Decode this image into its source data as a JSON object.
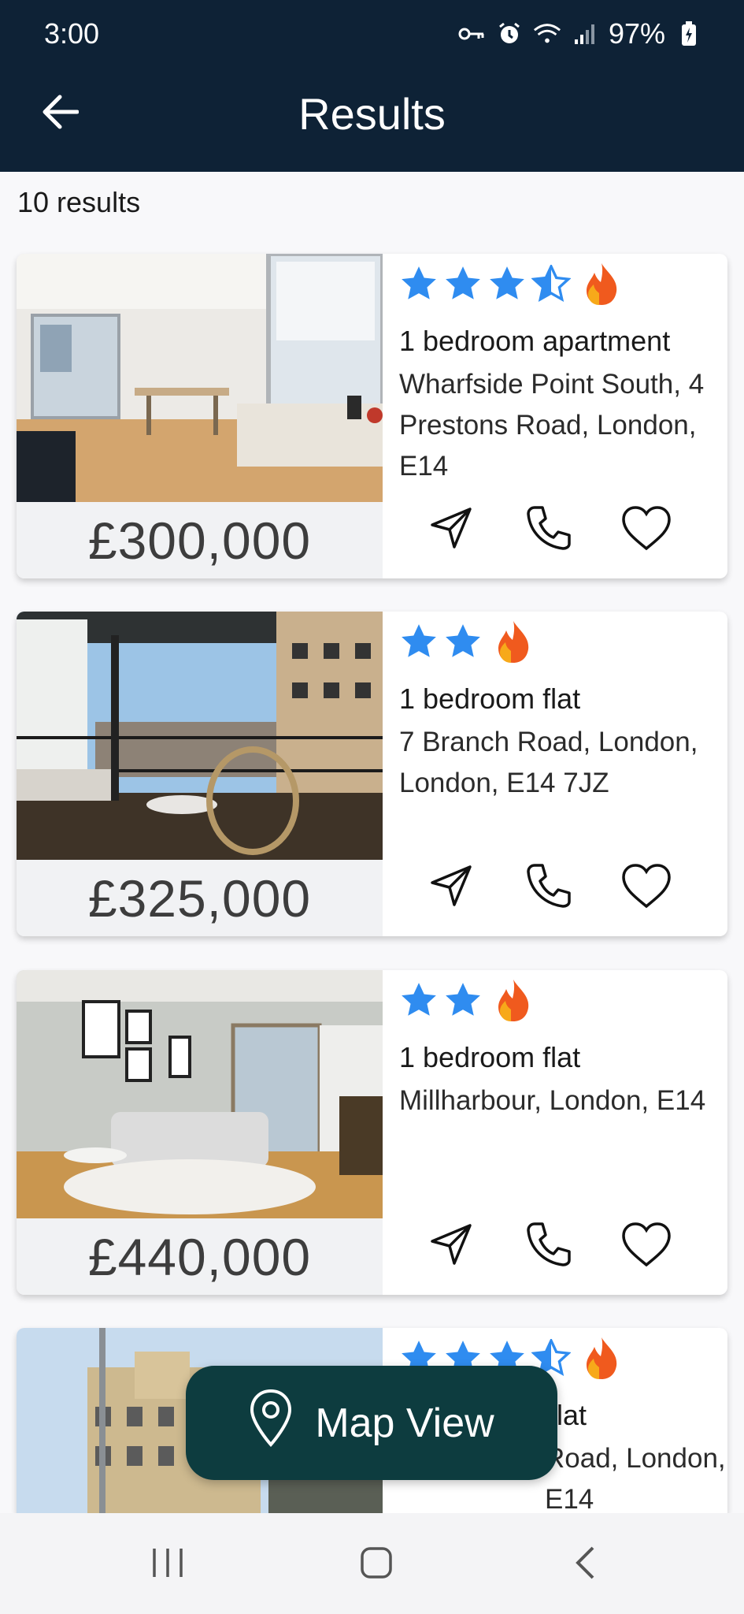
{
  "status_bar": {
    "time": "3:00",
    "battery": "97%"
  },
  "header": {
    "title": "Results"
  },
  "results_count": "10 results",
  "listings": [
    {
      "rating_stars": 3.5,
      "price": "£300,000",
      "title": "1 bedroom apartment",
      "address": "Wharfside Point South, 4 Prestons Road, London, E14"
    },
    {
      "rating_stars": 2,
      "price": "£325,000",
      "title": "1 bedroom flat",
      "address": "7 Branch Road, London, London, E14 7JZ"
    },
    {
      "rating_stars": 2,
      "price": "£440,000",
      "title": "1 bedroom flat",
      "address": "Millharbour, London, E14"
    },
    {
      "rating_stars": 3.5,
      "title": "lat",
      "address": "Road, London, E14"
    }
  ],
  "map_button": {
    "label": "Map View"
  },
  "colors": {
    "header_bg": "#0e2236",
    "star": "#2f8cf0",
    "map_button_bg": "#0d3c3f",
    "flame": "#f05a1e"
  },
  "icons": [
    "back-arrow-icon",
    "send-icon",
    "phone-icon",
    "heart-icon",
    "map-pin-icon",
    "flame-icon",
    "star-icon",
    "recent-apps-icon",
    "home-icon",
    "nav-back-icon"
  ]
}
